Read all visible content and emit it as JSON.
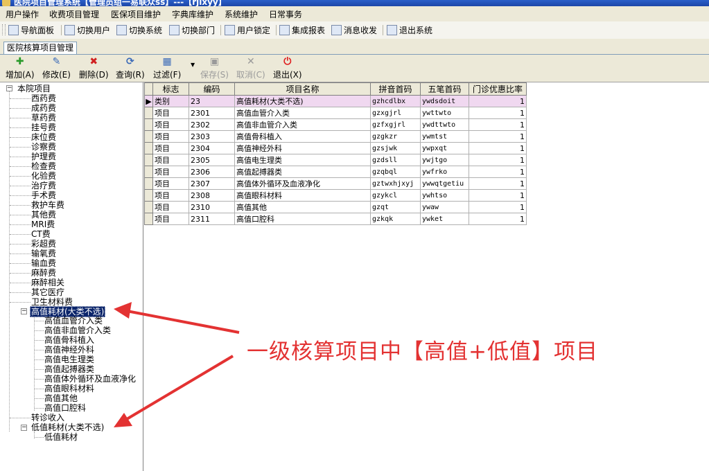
{
  "title_bar": {
    "text": "医院项目管理系统【管理员组一易联众ss】---【rjlxyy】"
  },
  "menu": [
    "用户操作",
    "收费项目管理",
    "医保项目维护",
    "字典库维护",
    "系统维护",
    "日常事务"
  ],
  "toolbar": [
    {
      "label": "导航面板",
      "icon": "navigation-panel-icon"
    },
    {
      "label": "切换用户",
      "icon": "switch-user-icon"
    },
    {
      "label": "切换系统",
      "icon": "switch-system-icon"
    },
    {
      "label": "切换部门",
      "icon": "switch-department-icon"
    },
    {
      "label": "用户锁定",
      "icon": "user-lock-icon"
    },
    {
      "label": "集成报表",
      "icon": "report-icon"
    },
    {
      "label": "消息收发",
      "icon": "message-icon"
    },
    {
      "label": "退出系统",
      "icon": "exit-system-icon"
    }
  ],
  "tab": {
    "label": "医院核算项目管理"
  },
  "actions": [
    {
      "label": "增加(A)",
      "icon": "add-icon",
      "enabled": true
    },
    {
      "label": "修改(E)",
      "icon": "edit-icon",
      "enabled": true
    },
    {
      "label": "删除(D)",
      "icon": "delete-icon",
      "enabled": true
    },
    {
      "label": "查询(R)",
      "icon": "query-icon",
      "enabled": true
    },
    {
      "label": "过滤(F)",
      "icon": "filter-icon",
      "enabled": true
    },
    {
      "label": "保存(S)",
      "icon": "save-icon",
      "enabled": false
    },
    {
      "label": "取消(C)",
      "icon": "cancel-icon",
      "enabled": false
    },
    {
      "label": "退出(X)",
      "icon": "power-icon",
      "enabled": true
    }
  ],
  "tree": {
    "root": "本院项目",
    "items": [
      "西药费",
      "成药费",
      "草药费",
      "挂号费",
      "床位费",
      "诊察费",
      "护理费",
      "检查费",
      "化验费",
      "治疗费",
      "手术费",
      "救护车费",
      "其他费",
      "MRI费",
      "CT费",
      "彩超费",
      "输氧费",
      "输血费",
      "麻醉费",
      "麻醉相关",
      "其它医疗",
      "卫生材料费"
    ],
    "high_value": {
      "label": "高值耗材(大类不选)",
      "children": [
        "高值血管介入类",
        "高值非血管介入类",
        "高值骨科植入",
        "高值神经外科",
        "高值电生理类",
        "高值起搏器类",
        "高值体外循环及血液净化",
        "高值眼科材料",
        "高值其他",
        "高值口腔科"
      ]
    },
    "referral": "转诊收入",
    "low_value": {
      "label": "低值耗材(大类不选)",
      "children": [
        "低值耗材"
      ]
    }
  },
  "grid": {
    "headers": [
      "标志",
      "编码",
      "项目名称",
      "拼音首码",
      "五笔首码",
      "门诊优惠比率"
    ],
    "rows": [
      [
        "类别",
        "23",
        "高值耗材(大类不选)",
        "gzhcdlbx",
        "ywdsdoit",
        "1"
      ],
      [
        "项目",
        "2301",
        "高值血管介入类",
        "gzxgjrl",
        "ywttwto",
        "1"
      ],
      [
        "项目",
        "2302",
        "高值非血管介入类",
        "gzfxgjrl",
        "ywdttwto",
        "1"
      ],
      [
        "项目",
        "2303",
        "高值骨科植入",
        "gzgkzr",
        "ywmtst",
        "1"
      ],
      [
        "项目",
        "2304",
        "高值神经外科",
        "gzsjwk",
        "ywpxqt",
        "1"
      ],
      [
        "项目",
        "2305",
        "高值电生理类",
        "gzdsll",
        "ywjtgo",
        "1"
      ],
      [
        "项目",
        "2306",
        "高值起搏器类",
        "gzqbql",
        "ywfrko",
        "1"
      ],
      [
        "项目",
        "2307",
        "高值体外循环及血液净化",
        "gztwxhjxyj",
        "ywwqtgetiu",
        "1"
      ],
      [
        "项目",
        "2308",
        "高值眼科材料",
        "gzykcl",
        "ywhtso",
        "1"
      ],
      [
        "项目",
        "2310",
        "高值其他",
        "gzqt",
        "ywaw",
        "1"
      ],
      [
        "项目",
        "2311",
        "高值口腔科",
        "gzkqk",
        "ywket",
        "1"
      ]
    ]
  },
  "annotation": {
    "text": "一级核算项目中【高值+低值】项目",
    "color": "#e33232"
  }
}
